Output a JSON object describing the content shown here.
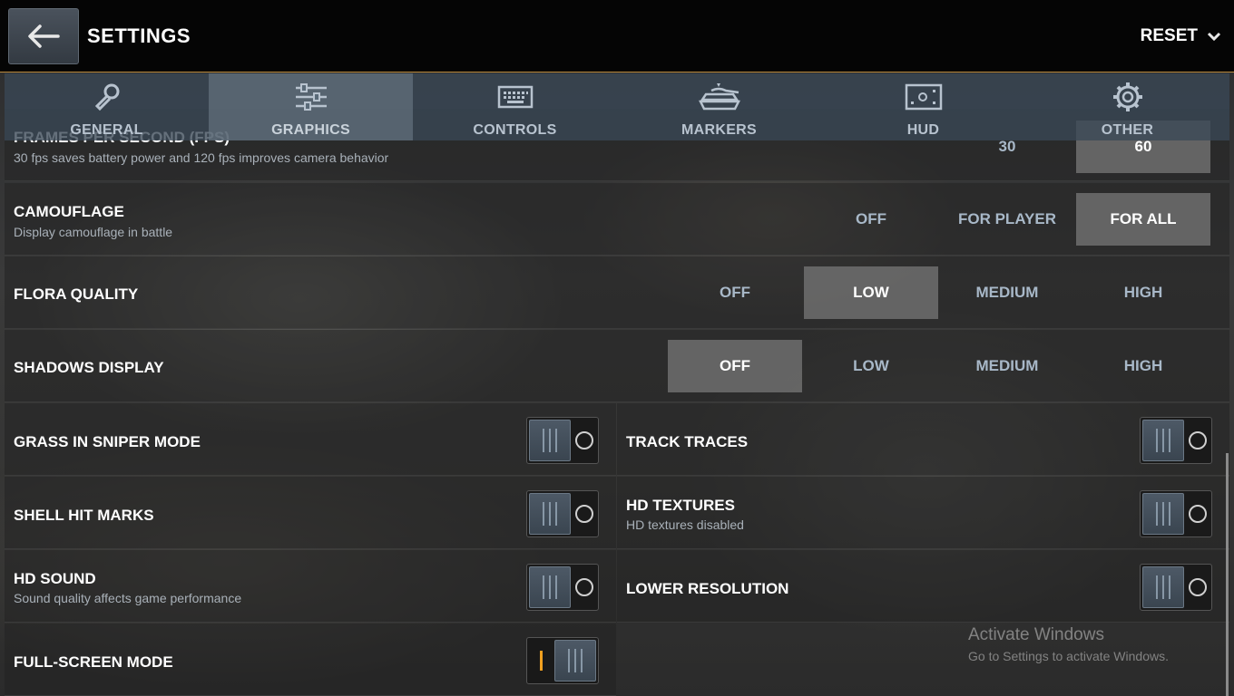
{
  "header": {
    "title": "SETTINGS",
    "reset_label": "RESET"
  },
  "tabs": [
    {
      "label": "GENERAL",
      "icon": "wrench-icon",
      "active": false
    },
    {
      "label": "GRAPHICS",
      "icon": "sliders-icon",
      "active": true
    },
    {
      "label": "CONTROLS",
      "icon": "keyboard-icon",
      "active": false
    },
    {
      "label": "MARKERS",
      "icon": "tank-icon",
      "active": false
    },
    {
      "label": "HUD",
      "icon": "hud-screen-icon",
      "active": false
    },
    {
      "label": "OTHER",
      "icon": "gear-icon",
      "active": false
    }
  ],
  "settings": {
    "fps": {
      "label": "FRAMES PER SECOND (FPS)",
      "description": "30 fps saves battery power and 120 fps improves camera behavior",
      "options": [
        "30",
        "60"
      ],
      "selected": "60"
    },
    "camouflage": {
      "label": "CAMOUFLAGE",
      "description": "Display camouflage in battle",
      "options": [
        "OFF",
        "FOR PLAYER",
        "FOR ALL"
      ],
      "selected": "FOR ALL"
    },
    "flora_quality": {
      "label": "FLORA QUALITY",
      "options": [
        "OFF",
        "LOW",
        "MEDIUM",
        "HIGH"
      ],
      "selected": "LOW"
    },
    "shadows_display": {
      "label": "SHADOWS DISPLAY",
      "options": [
        "OFF",
        "LOW",
        "MEDIUM",
        "HIGH"
      ],
      "selected": "OFF"
    },
    "grass_in_sniper_mode": {
      "label": "GRASS IN SNIPER MODE",
      "enabled": false
    },
    "track_traces": {
      "label": "TRACK TRACES",
      "enabled": false
    },
    "shell_hit_marks": {
      "label": "SHELL HIT MARKS",
      "enabled": false
    },
    "hd_textures": {
      "label": "HD TEXTURES",
      "description": "HD textures disabled",
      "enabled": false
    },
    "hd_sound": {
      "label": "HD SOUND",
      "description": "Sound quality affects game performance",
      "enabled": false
    },
    "lower_resolution": {
      "label": "LOWER RESOLUTION",
      "enabled": false
    },
    "full_screen_mode": {
      "label": "FULL-SCREEN MODE",
      "enabled": true
    }
  },
  "watermark": {
    "title": "Activate Windows",
    "subtitle": "Go to Settings to activate Windows."
  },
  "colors": {
    "accent_border": "#b98a3e",
    "toggle_on": "#f0a020"
  }
}
